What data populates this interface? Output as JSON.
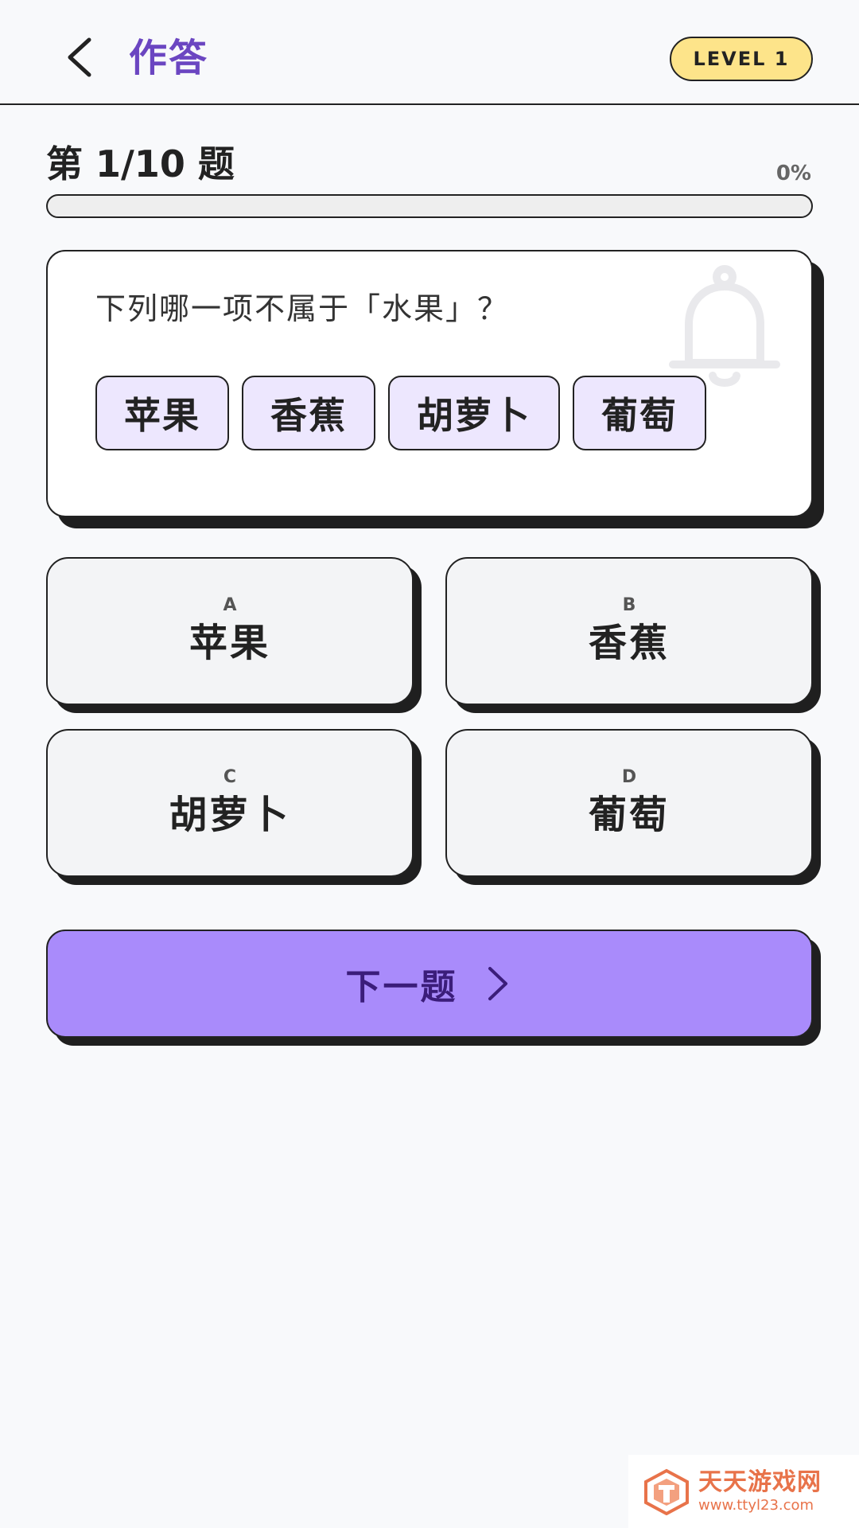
{
  "header": {
    "title": "作答",
    "level_badge": "LEVEL 1"
  },
  "progress": {
    "counter": "第 1/10 题",
    "percent_label": "0%",
    "fraction": 0.0
  },
  "question": {
    "text": "下列哪一项不属于「水果」？",
    "chips": [
      "苹果",
      "香蕉",
      "胡萝卜",
      "葡萄"
    ]
  },
  "options": [
    {
      "letter": "A",
      "text": "苹果"
    },
    {
      "letter": "B",
      "text": "香蕉"
    },
    {
      "letter": "C",
      "text": "胡萝卜"
    },
    {
      "letter": "D",
      "text": "葡萄"
    }
  ],
  "next_button": {
    "label": "下一题"
  },
  "watermark": {
    "name": "天天游戏网",
    "url": "www.ttyl23.com"
  },
  "colors": {
    "accent": "#6b46c1",
    "button": "#a98bfb",
    "chip": "#ede7fe",
    "badge": "#fde48a"
  },
  "icons": {
    "back": "chevron-left-icon",
    "decor": "bell-icon",
    "next": "chevron-right-icon"
  }
}
